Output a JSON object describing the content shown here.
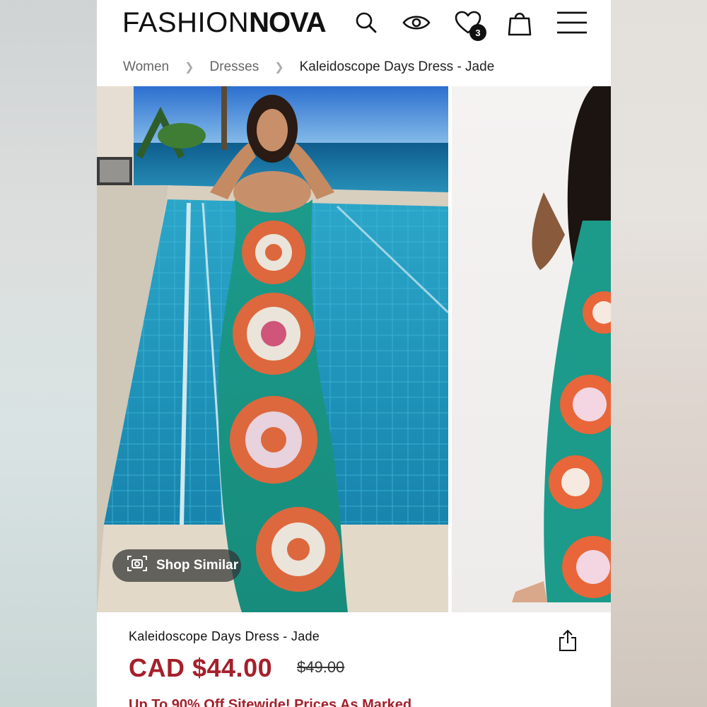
{
  "header": {
    "logo_left": "FASHION",
    "logo_right": "NOVA",
    "wishlist_count": "3",
    "icons": [
      "search-icon",
      "eye-icon",
      "heart-icon",
      "bag-icon",
      "menu-icon"
    ]
  },
  "breadcrumb": {
    "items": [
      "Women",
      "Dresses",
      "Kaleidoscope Days Dress - Jade"
    ]
  },
  "gallery": {
    "shop_similar_label": "Shop Similar"
  },
  "product": {
    "title": "Kaleidoscope Days Dress - Jade",
    "price": "CAD $44.00",
    "compare_price": "$49.00",
    "promo": "Up To 90% Off Sitewide! Prices As Marked",
    "accent_color": "#a4202b"
  }
}
